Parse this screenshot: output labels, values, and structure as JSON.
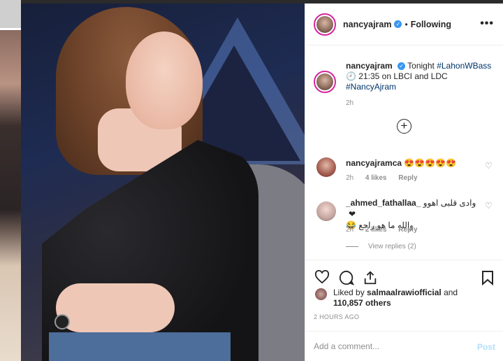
{
  "post": {
    "username": "nancyajram",
    "follow_sep": "•",
    "follow_status": "Following",
    "more_label": "•••"
  },
  "caption": {
    "username": "nancyajram",
    "text_before": "Tonight ",
    "hashtag1": "#LahonWBass",
    "text_middle": "🕘 21:35 on LBCI and LDC",
    "hashtag2": "#NancyAjram",
    "time": "2h"
  },
  "load_more_label": "+",
  "comments": [
    {
      "username": "nancyajramca",
      "text": "😍😍😍😍😍",
      "time": "2h",
      "likes": "4 likes",
      "reply": "Reply"
    },
    {
      "username": "_ahmed_fathallaa_",
      "text_line1": "وادى قلبى اهوو ❤",
      "text_line2": "والله ما هو راجع 😂",
      "time": "2h",
      "likes": "2 likes",
      "reply": "Reply"
    }
  ],
  "view_replies": "View replies (2)",
  "likes": {
    "prefix": "Liked by ",
    "user": "salmaalrawiofficial",
    "and": " and",
    "count": "110,857 others"
  },
  "timestamp": "2 HOURS AGO",
  "comment_box": {
    "placeholder": "Add a comment...",
    "post_label": "Post"
  },
  "colors": {
    "link": "#003569",
    "verified": "#3897f0",
    "post_disabled": "#b2dffc"
  }
}
